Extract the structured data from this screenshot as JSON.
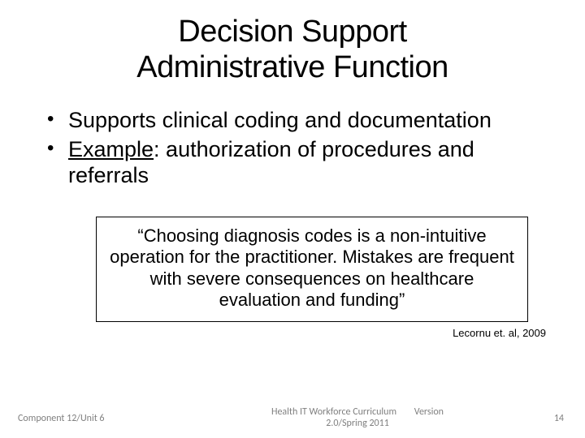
{
  "title_line1": "Decision Support",
  "title_line2": "Administrative Function",
  "bullets": {
    "b1": "Supports clinical coding and documentation",
    "b2_label": "Example",
    "b2_rest": ": authorization of procedures and referrals"
  },
  "quote": "“Choosing diagnosis codes is a non-intuitive operation for the practitioner. Mistakes are frequent with severe consequences on healthcare evaluation and funding”",
  "citation": "Lecornu et. al, 2009",
  "footer": {
    "left": "Component 12/Unit 6",
    "center_line1": "Health IT Workforce Curriculum",
    "center_line2": "2.0/Spring 2011",
    "version_label": "Version",
    "page": "14"
  }
}
